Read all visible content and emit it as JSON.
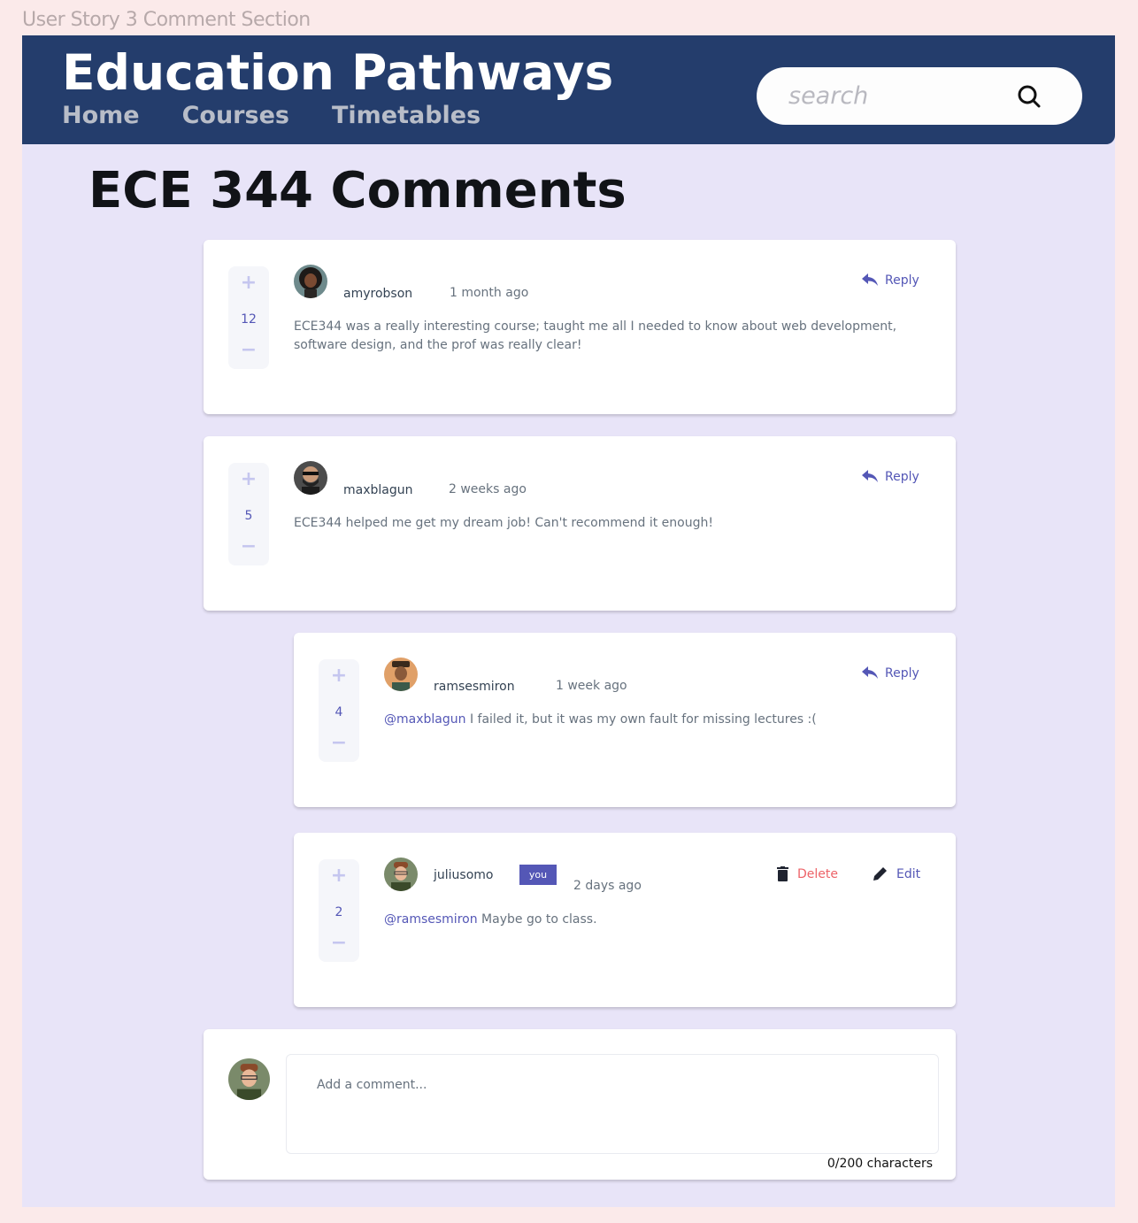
{
  "frame_label": "User Story 3 Comment Section",
  "header": {
    "brand": "Education Pathways",
    "nav": [
      "Home",
      "Courses",
      "Timetables"
    ],
    "search_placeholder": "search"
  },
  "page_title": "ECE 344 Comments",
  "comments": [
    {
      "username": "amyrobson",
      "time": "1 month ago",
      "score": "12",
      "text": "ECE344 was a really interesting course; taught me all I needed to know about web development, software design, and the prof was really clear!",
      "reply_label": "Reply"
    },
    {
      "username": "maxblagun",
      "time": "2 weeks ago",
      "score": "5",
      "text": "ECE344 helped me get my dream job! Can't recommend it enough!",
      "reply_label": "Reply"
    },
    {
      "username": "ramsesmiron",
      "time": "1 week ago",
      "score": "4",
      "mention": "@maxblagun",
      "text": " I failed it, but it was my own fault for missing lectures :(",
      "reply_label": "Reply"
    },
    {
      "username": "juliusomo",
      "badge": "you",
      "time": "2 days ago",
      "score": "2",
      "mention": "@ramsesmiron",
      "text": " Maybe go to class.",
      "delete_label": "Delete",
      "edit_label": "Edit"
    }
  ],
  "composer": {
    "placeholder": "Add a comment...",
    "char_count": "0/200 characters"
  },
  "colors": {
    "header_bg": "#243d6c",
    "accent": "#5457b6",
    "delete": "#ed6368",
    "frame_bg": "#e8e4f8"
  },
  "icons": [
    "search-icon",
    "reply-icon",
    "delete-icon",
    "edit-icon",
    "plus-icon",
    "minus-icon"
  ]
}
